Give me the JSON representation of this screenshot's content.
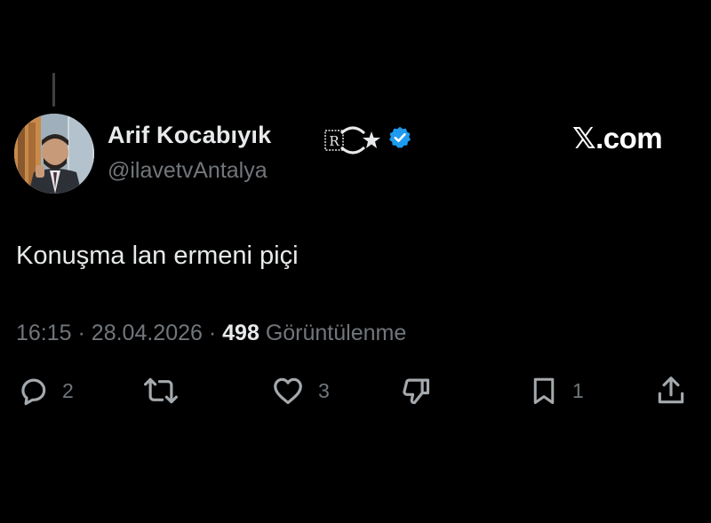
{
  "tweet": {
    "author": {
      "display_name": "Arif Kocabıyık",
      "handle": "@ilavetvAntalya",
      "verified": true,
      "verified_color": "#1d9bf0",
      "affiliate_badge_letter": "R"
    },
    "site_logo": "𝕏.com",
    "text": "Konuşma lan ermeni piçi",
    "meta": {
      "time": "16:15",
      "separator": "·",
      "date": "28.04.2026",
      "views_count": "498",
      "views_label": "Görüntülenme"
    },
    "actions": {
      "replies": "2",
      "likes": "3",
      "bookmarks": "1"
    }
  },
  "colors": {
    "background": "#000000",
    "primary_text": "#e7e9ea",
    "secondary_text": "#71767b",
    "accent": "#1d9bf0"
  }
}
